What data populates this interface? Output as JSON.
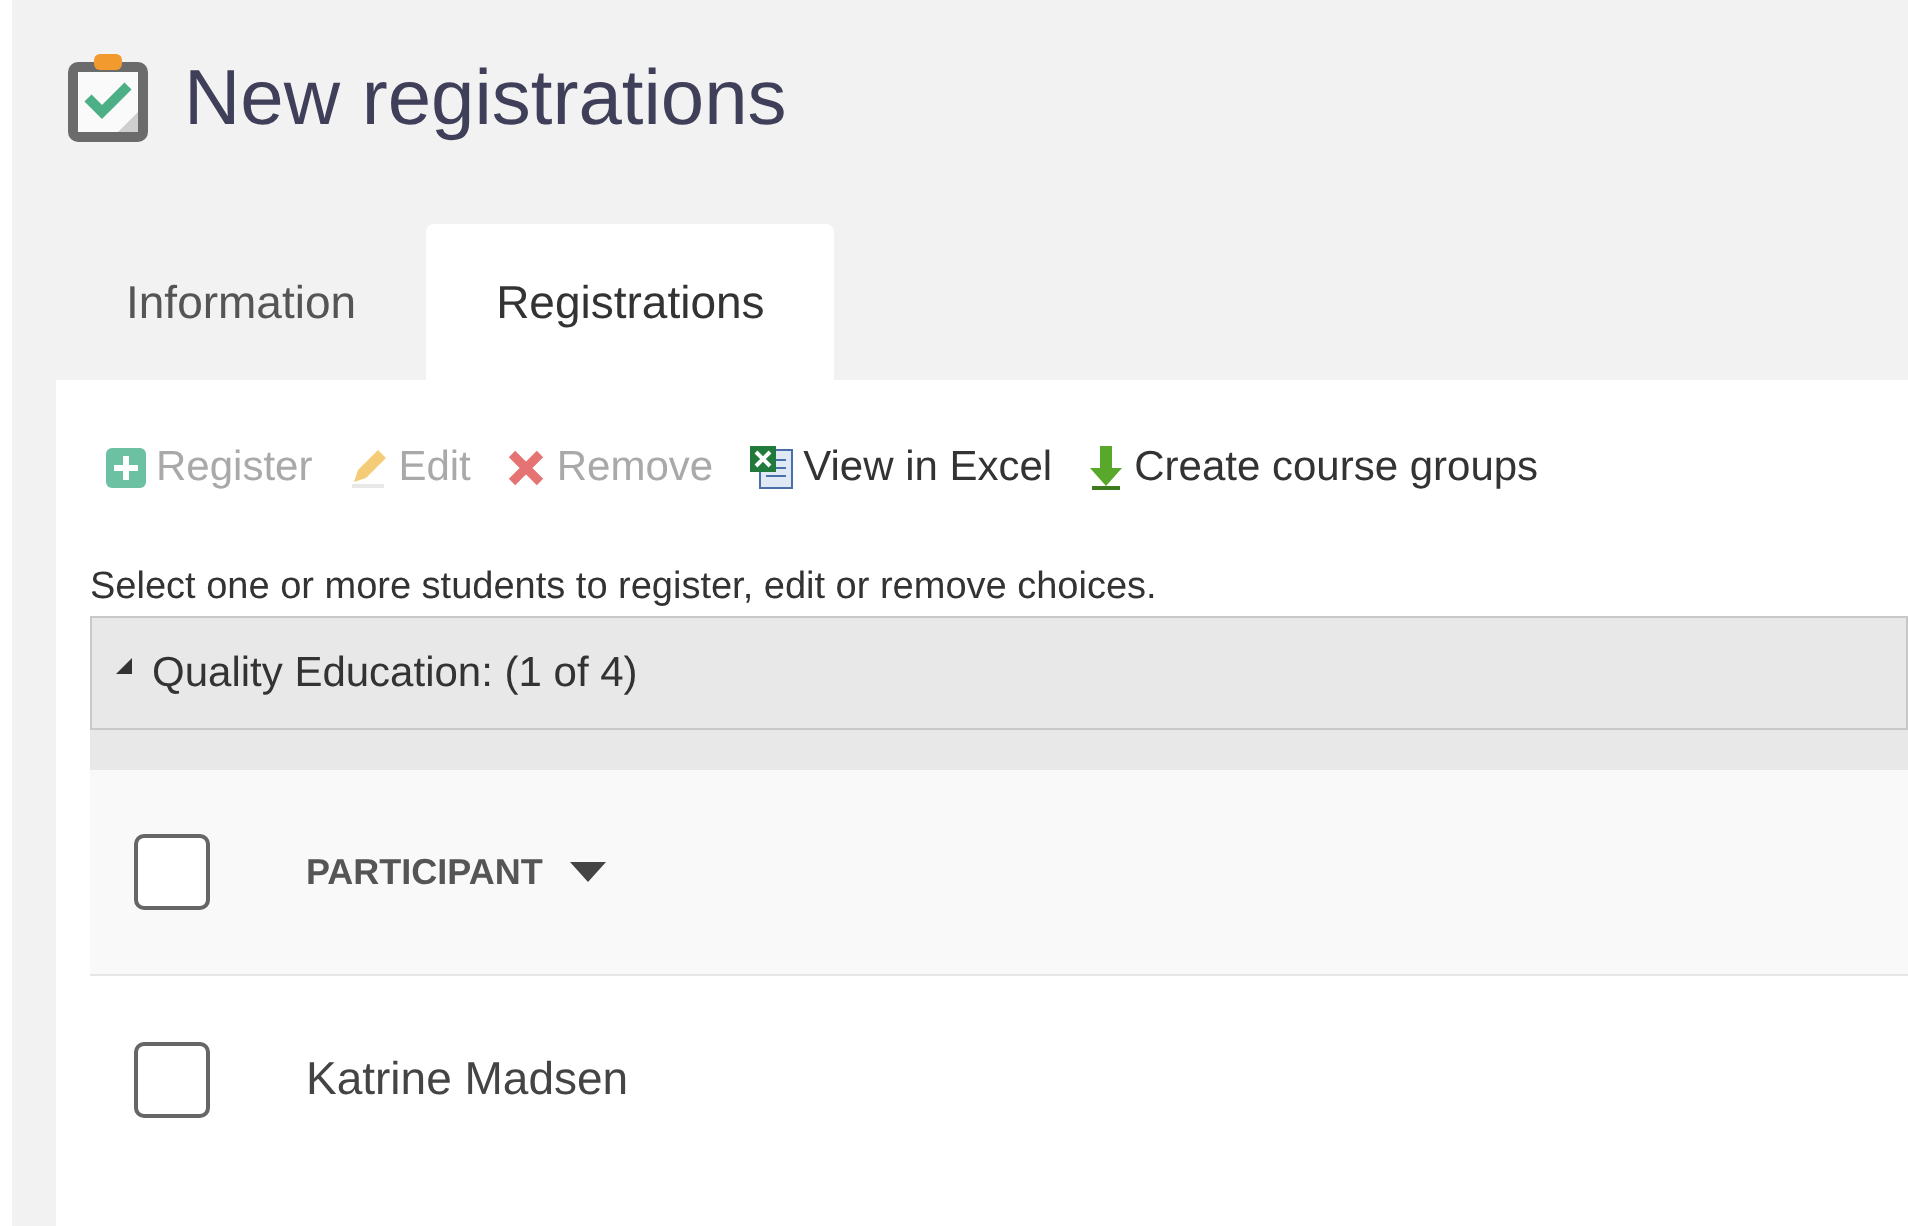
{
  "page": {
    "title": "New registrations"
  },
  "tabs": [
    {
      "label": "Information",
      "selected": false
    },
    {
      "label": "Registrations",
      "selected": true
    }
  ],
  "toolbar": [
    {
      "kind": "add",
      "label": "Register",
      "disabled": true
    },
    {
      "kind": "edit",
      "label": "Edit",
      "disabled": true
    },
    {
      "kind": "remove",
      "label": "Remove",
      "disabled": true
    },
    {
      "kind": "excel",
      "label": "View in Excel",
      "disabled": false
    },
    {
      "kind": "download",
      "label": "Create course groups",
      "disabled": false
    }
  ],
  "instruction": "Select one or more students to register, edit or remove choices.",
  "group": {
    "label": "Quality Education: (1 of 4)",
    "expanded": true
  },
  "table": {
    "select_all_checked": false,
    "columns": [
      {
        "label": "PARTICIPANT",
        "sorted": true
      }
    ],
    "rows": [
      {
        "participant": "Katrine Madsen",
        "checked": false
      }
    ]
  }
}
